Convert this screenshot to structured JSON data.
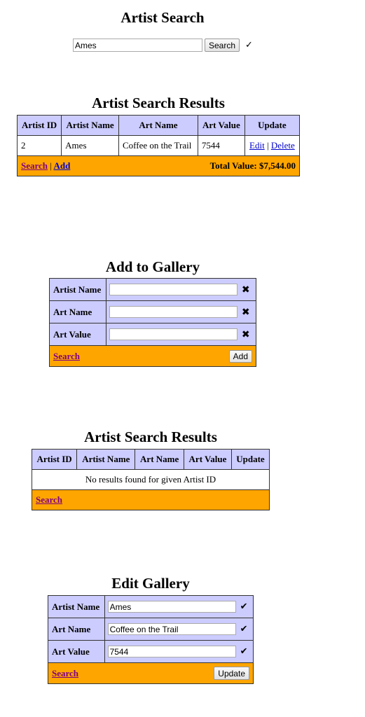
{
  "search_panel": {
    "title": "Artist Search",
    "input_value": "Ames",
    "button_label": "Search",
    "status_icon": "✓"
  },
  "results_panel_1": {
    "title": "Artist Search Results",
    "columns": [
      "Artist ID",
      "Artist Name",
      "Art Name",
      "Art Value",
      "Update"
    ],
    "rows": [
      {
        "artist_id": "2",
        "artist_name": "Ames",
        "art_name": "Coffee on the Trail",
        "art_value": "7544",
        "edit_label": "Edit",
        "separator": "|",
        "delete_label": "Delete"
      }
    ],
    "footer": {
      "search_link": "Search",
      "separator": "|",
      "add_link": "Add",
      "total_label": "Total Value: $7,544.00"
    }
  },
  "add_panel": {
    "title": "Add to Gallery",
    "fields": [
      {
        "label": "Artist Name",
        "value": "",
        "icon": "✖"
      },
      {
        "label": "Art Name",
        "value": "",
        "icon": "✖"
      },
      {
        "label": "Art Value",
        "value": "",
        "icon": "✖"
      }
    ],
    "footer": {
      "search_link": "Search",
      "button_label": "Add"
    }
  },
  "results_panel_2": {
    "title": "Artist Search Results",
    "columns": [
      "Artist ID",
      "Artist Name",
      "Art Name",
      "Art Value",
      "Update"
    ],
    "empty_message": "No results found for given Artist ID",
    "footer": {
      "search_link": "Search"
    }
  },
  "edit_panel": {
    "title": "Edit Gallery",
    "fields": [
      {
        "label": "Artist Name",
        "value": "Ames",
        "icon": "✔"
      },
      {
        "label": "Art Name",
        "value": "Coffee on the Trail",
        "icon": "✔"
      },
      {
        "label": "Art Value",
        "value": "7544",
        "icon": "✔"
      }
    ],
    "footer": {
      "search_link": "Search",
      "button_label": "Update"
    }
  },
  "colors": {
    "header_bg": "#ccccff",
    "footer_bg": "#ffa500",
    "link": "#0000cc",
    "visited_link": "#800080"
  }
}
